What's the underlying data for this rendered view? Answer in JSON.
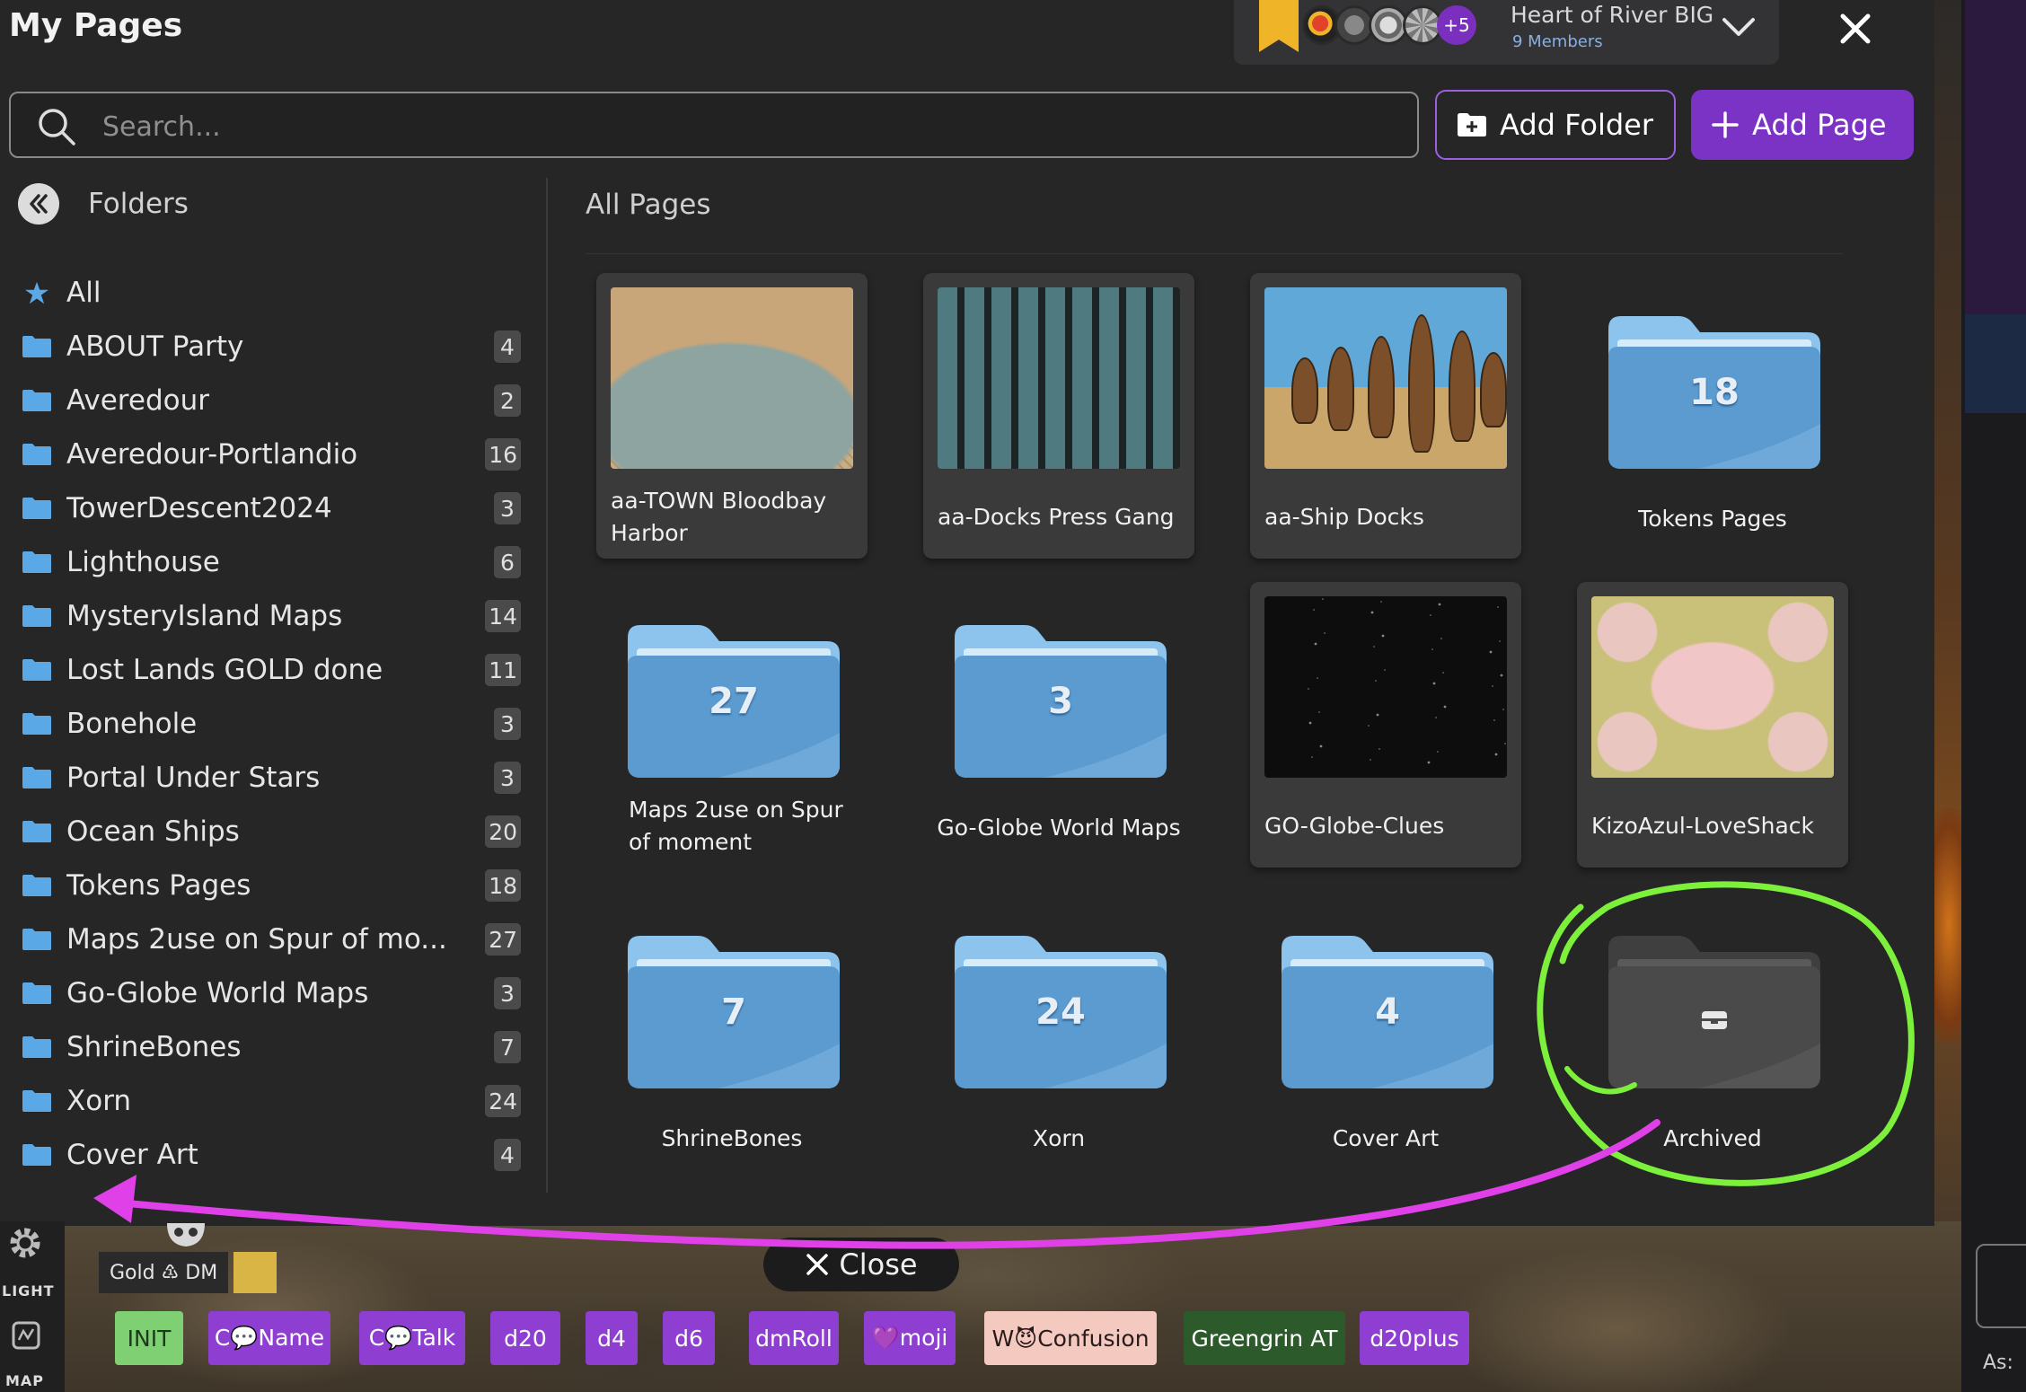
{
  "app": {
    "title": "My Pages"
  },
  "group": {
    "name": "Heart of River BIG",
    "members": "9 Members",
    "more_count": "+5"
  },
  "search": {
    "placeholder": "Search..."
  },
  "toolbar": {
    "add_folder_label": "Add Folder",
    "add_page_label": "Add Page"
  },
  "sidebar": {
    "header": "Folders",
    "items": [
      {
        "label": "All",
        "count": "",
        "icon": "star-icon"
      },
      {
        "label": "ABOUT Party",
        "count": "4",
        "icon": "folder-icon"
      },
      {
        "label": "Averedour",
        "count": "2",
        "icon": "folder-icon"
      },
      {
        "label": "Averedour-Portlandio",
        "count": "16",
        "icon": "folder-icon"
      },
      {
        "label": "TowerDescent2024",
        "count": "3",
        "icon": "folder-icon"
      },
      {
        "label": "Lighthouse",
        "count": "6",
        "icon": "folder-icon"
      },
      {
        "label": "MysteryIsland Maps",
        "count": "14",
        "icon": "folder-icon"
      },
      {
        "label": "Lost Lands GOLD done",
        "count": "11",
        "icon": "folder-icon"
      },
      {
        "label": "Bonehole",
        "count": "3",
        "icon": "folder-icon"
      },
      {
        "label": "Portal Under Stars",
        "count": "3",
        "icon": "folder-icon"
      },
      {
        "label": "Ocean Ships",
        "count": "20",
        "icon": "folder-icon"
      },
      {
        "label": "Tokens Pages",
        "count": "18",
        "icon": "folder-icon"
      },
      {
        "label": "Maps 2use on Spur of mo...",
        "count": "27",
        "icon": "folder-icon"
      },
      {
        "label": "Go-Globe World Maps",
        "count": "3",
        "icon": "folder-icon"
      },
      {
        "label": "ShrineBones",
        "count": "7",
        "icon": "folder-icon"
      },
      {
        "label": "Xorn",
        "count": "24",
        "icon": "folder-icon"
      },
      {
        "label": "Cover Art",
        "count": "4",
        "icon": "folder-icon"
      }
    ]
  },
  "main": {
    "heading": "All Pages",
    "cards": [
      {
        "kind": "page",
        "label": "aa-TOWN Bloodbay Harbor",
        "thumb": "town-map"
      },
      {
        "kind": "page",
        "label": "aa-Docks Press Gang",
        "thumb": "docks-map"
      },
      {
        "kind": "page",
        "label": "aa-Ship Docks",
        "thumb": "ship-docks-map"
      },
      {
        "kind": "folder",
        "label": "Tokens Pages",
        "count": "18"
      },
      {
        "kind": "folder",
        "label": "Maps 2use on Spur of moment",
        "count": "27"
      },
      {
        "kind": "folder",
        "label": "Go-Globe World Maps",
        "count": "3"
      },
      {
        "kind": "page",
        "label": "GO-Globe-Clues",
        "thumb": "starfield"
      },
      {
        "kind": "page",
        "label": "KizoAzul-LoveShack",
        "thumb": "building-floorplan"
      },
      {
        "kind": "folder",
        "label": "ShrineBones",
        "count": "7"
      },
      {
        "kind": "folder",
        "label": "Xorn",
        "count": "24"
      },
      {
        "kind": "folder",
        "label": "Cover Art",
        "count": "4"
      },
      {
        "kind": "archived-folder",
        "label": "Archived",
        "icon": "archive-box-icon"
      }
    ]
  },
  "bottom": {
    "light_label": "LIGHT",
    "map_label": "MAP",
    "dm_tag": "Gold ♳ DM",
    "close_label": "Close",
    "side_label": "As:",
    "macros": [
      {
        "label": "INIT",
        "color": "#7fcf73",
        "text": "#1c3a1a"
      },
      {
        "label": "C💬Name",
        "color": "#8e3fd1",
        "text": "#ffffff"
      },
      {
        "label": "C💬Talk",
        "color": "#8e3fd1",
        "text": "#ffffff"
      },
      {
        "label": "d20",
        "color": "#8e3fd1",
        "text": "#ffffff"
      },
      {
        "label": "d4",
        "color": "#8e3fd1",
        "text": "#ffffff"
      },
      {
        "label": "d6",
        "color": "#8e3fd1",
        "text": "#ffffff"
      },
      {
        "label": "dmRoll",
        "color": "#8e3fd1",
        "text": "#ffffff"
      },
      {
        "label": "💜moji",
        "color": "#8e3fd1",
        "text": "#ffffff"
      },
      {
        "label": "W😈Confusion",
        "color": "#f3c9c0",
        "text": "#2a1a1a"
      },
      {
        "label": "Greengrin AT",
        "color": "#2c5a2a",
        "text": "#ffffff"
      },
      {
        "label": "d20plus",
        "color": "#8e3fd1",
        "text": "#ffffff"
      }
    ]
  },
  "colors": {
    "accent": "#7a33c4",
    "folder_blue": "#5b9bd0",
    "annotation_green": "#7cf03a",
    "annotation_magenta": "#e040e8"
  }
}
